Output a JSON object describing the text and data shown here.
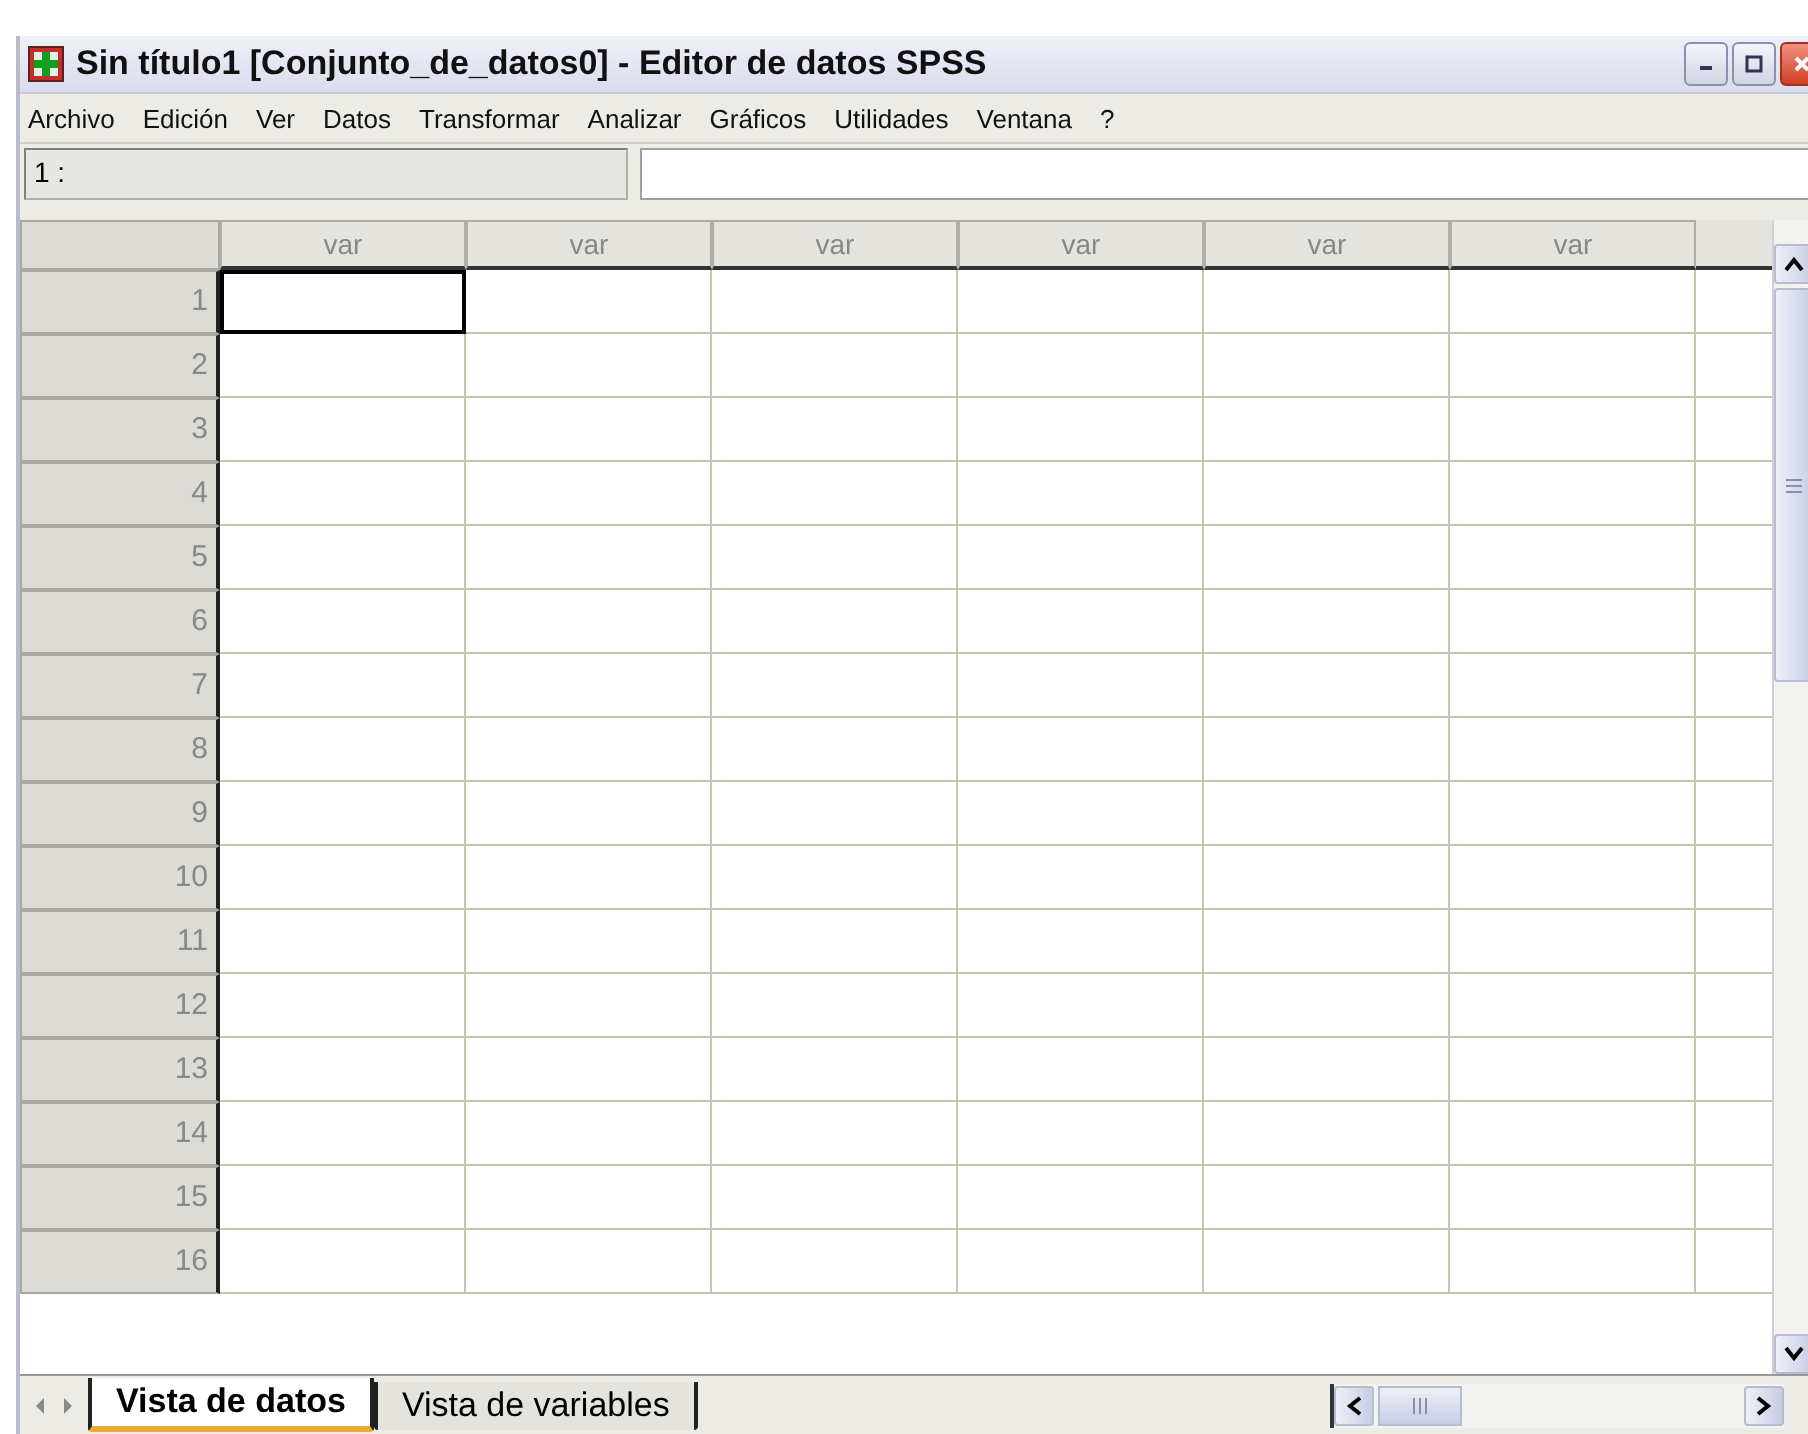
{
  "window": {
    "title": "Sin título1 [Conjunto_de_datos0] - Editor de datos SPSS"
  },
  "menu": [
    "Archivo",
    "Edición",
    "Ver",
    "Datos",
    "Transformar",
    "Analizar",
    "Gráficos",
    "Utilidades",
    "Ventana",
    "?"
  ],
  "cell_reference": {
    "label": "1 :"
  },
  "table": {
    "columns": [
      "var",
      "var",
      "var",
      "var",
      "var",
      "var"
    ],
    "rows": [
      {
        "label": "1",
        "selected": true
      },
      {
        "label": "2",
        "selected": false
      },
      {
        "label": "3",
        "selected": false
      },
      {
        "label": "4",
        "selected": false
      },
      {
        "label": "5",
        "selected": false
      },
      {
        "label": "6",
        "selected": false
      },
      {
        "label": "7",
        "selected": false
      },
      {
        "label": "8",
        "selected": false
      },
      {
        "label": "9",
        "selected": false
      },
      {
        "label": "10",
        "selected": false
      },
      {
        "label": "11",
        "selected": false
      },
      {
        "label": "12",
        "selected": false
      },
      {
        "label": "13",
        "selected": false
      },
      {
        "label": "14",
        "selected": false
      },
      {
        "label": "15",
        "selected": false
      },
      {
        "label": "16",
        "selected": false
      }
    ]
  },
  "tabs": [
    {
      "label": "Vista de datos",
      "selected": true
    },
    {
      "label": "Vista de variables",
      "selected": false
    }
  ]
}
